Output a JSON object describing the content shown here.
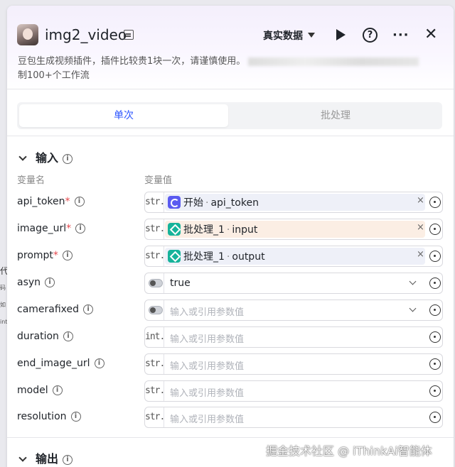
{
  "background": {
    "fragment": [
      "代",
      "码",
      "如",
      "int"
    ]
  },
  "header": {
    "title": "img2_video",
    "data_mode": "真实数据",
    "description_line1": "豆包生成视频插件，插件比较贵1块一次，请谨慎使用。",
    "description_line2": "制100+个工作流",
    "help": "?",
    "more": "···",
    "close": "✕"
  },
  "tabs": {
    "single": "单次",
    "batch": "批处理"
  },
  "input_section": {
    "title": "输入",
    "col_name": "变量名",
    "col_value": "变量值",
    "rows": [
      {
        "name": "api_token",
        "required": "*",
        "type": "str.",
        "ref_node": "开始",
        "ref_field": "api_token"
      },
      {
        "name": "image_url",
        "required": "*",
        "type": "str.",
        "ref_node": "批处理_1",
        "ref_field": "input"
      },
      {
        "name": "prompt",
        "required": "*",
        "type": "str.",
        "ref_node": "批处理_1",
        "ref_field": "output"
      },
      {
        "name": "asyn",
        "value": "true"
      },
      {
        "name": "camerafixed",
        "placeholder": "输入或引用参数值"
      },
      {
        "name": "duration",
        "type": "int.",
        "placeholder": "输入或引用参数值"
      },
      {
        "name": "end_image_url",
        "type": "str.",
        "placeholder": "输入或引用参数值"
      },
      {
        "name": "model",
        "type": "str.",
        "placeholder": "输入或引用参数值"
      },
      {
        "name": "resolution",
        "type": "str.",
        "placeholder": "输入或引用参数值"
      }
    ],
    "ref_separator": "·",
    "clear": "×"
  },
  "output_section": {
    "title": "输出"
  },
  "watermark": "掘金技术社区 @ iThinkAi智能体",
  "icons": [
    "plugin-avatar",
    "title-doc-icon",
    "caret-down-icon",
    "play-icon",
    "help-icon",
    "more-icon",
    "close-icon",
    "chevron-down-icon",
    "info-icon",
    "start-node-icon",
    "batch-node-icon",
    "toggle-icon",
    "target-icon"
  ],
  "colors": {
    "accent": "#2b54ff",
    "required": "#e5484d",
    "start_node": "#5b5bf0",
    "batch_node": "#16b39a"
  }
}
